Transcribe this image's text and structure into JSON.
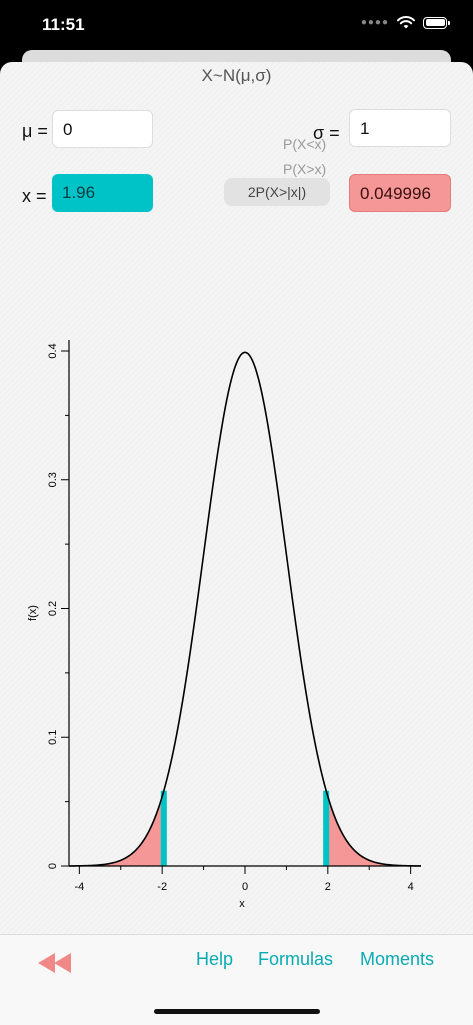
{
  "status": {
    "time": "11:51"
  },
  "title": "X~N(μ,σ)",
  "params": {
    "mu_label": "μ =",
    "mu_value": "0",
    "sigma_label": "σ =",
    "sigma_value": "1",
    "x_label": "x =",
    "x_value": "1.96"
  },
  "probability_options": [
    "P(X<x)",
    "P(X>x)",
    "2P(X>|x|)"
  ],
  "selected_option": "2P(X>|x|)",
  "result": "0.049996",
  "colors": {
    "accent": "#0aaab3",
    "x_field": "#00c3c8",
    "tail_fill": "#f49796",
    "x_marker": "#00c3c8"
  },
  "chart_data": {
    "type": "area",
    "function": "normal pdf",
    "mu": 0,
    "sigma": 1,
    "xlabel": "x",
    "ylabel": "f(x)",
    "xlim": [
      -4.25,
      4.25
    ],
    "ylim": [
      0,
      0.4
    ],
    "xticks": [
      "-4",
      "-2",
      "0",
      "2",
      "4"
    ],
    "yticks": [
      "0",
      "0.1",
      "0.2",
      "0.3",
      "0.4"
    ],
    "shaded_regions": [
      {
        "from": -4.25,
        "to": -1.96
      },
      {
        "from": 1.96,
        "to": 4.25
      }
    ],
    "markers_x": [
      -1.96,
      1.96
    ],
    "grid": false
  },
  "toolbar": {
    "rewind_icon": "rewind-icon",
    "help": "Help",
    "formulas": "Formulas",
    "moments": "Moments"
  }
}
